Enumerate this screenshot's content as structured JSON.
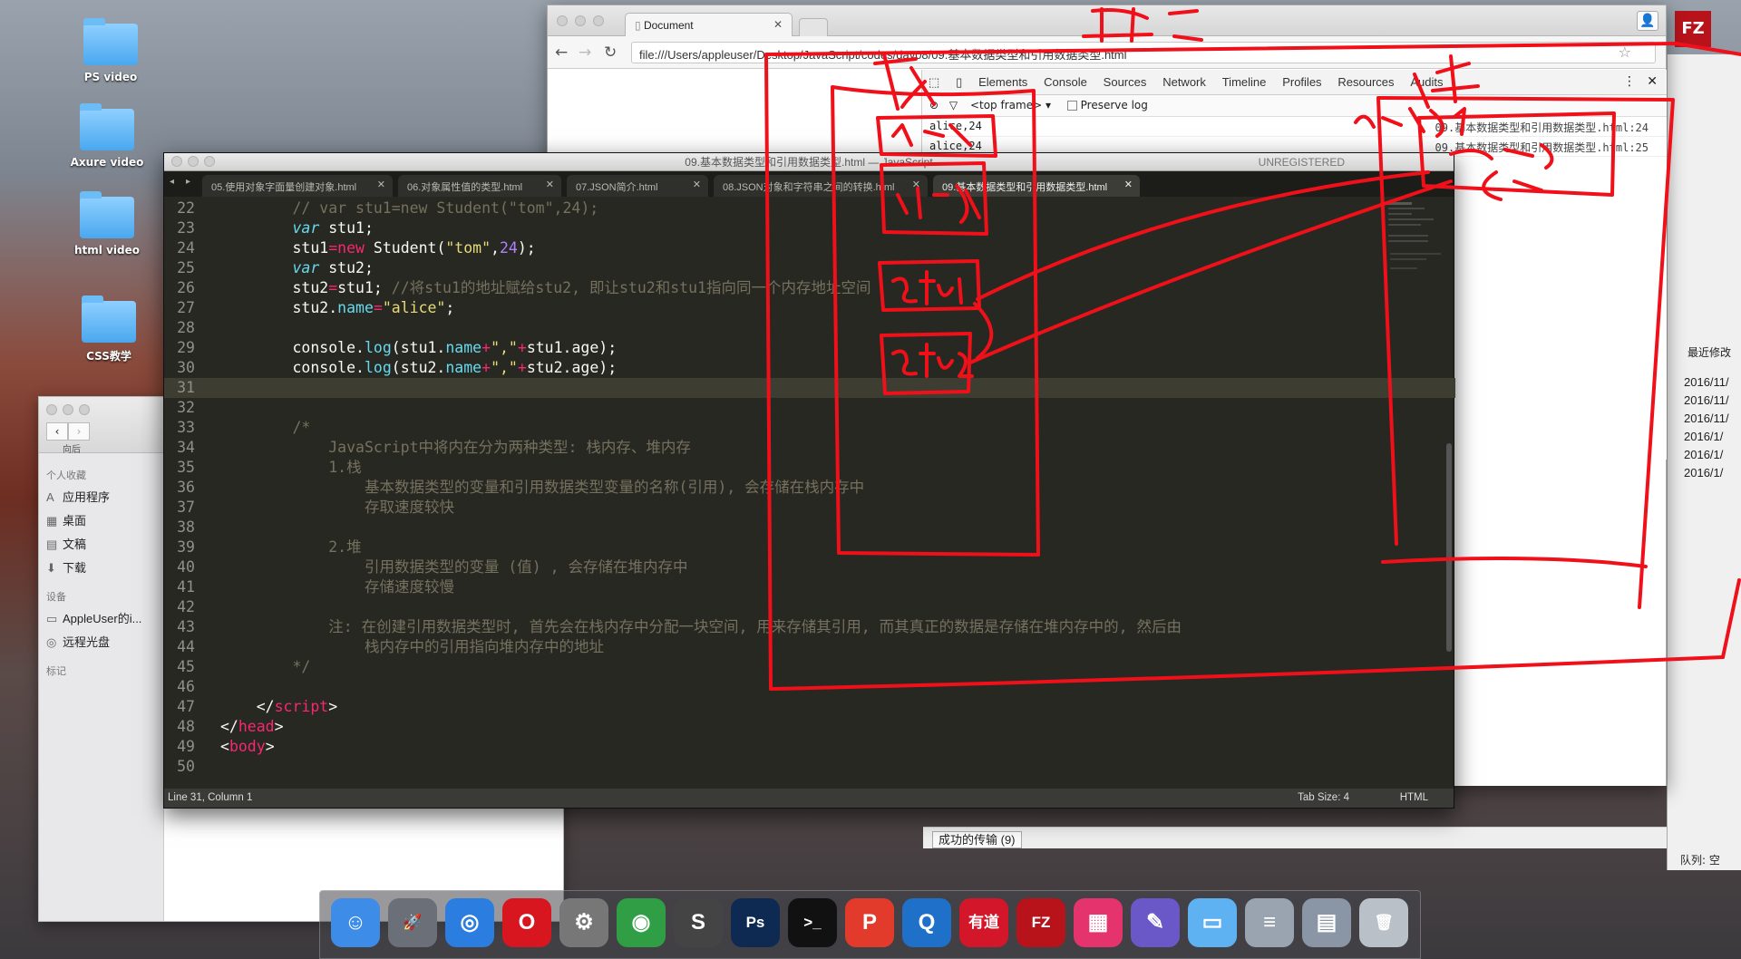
{
  "desktop": {
    "icons": [
      {
        "label": "PS video"
      },
      {
        "label": "Axure video"
      },
      {
        "label": "html video"
      },
      {
        "label": "CSS教学"
      }
    ]
  },
  "browser": {
    "tab_title": "Document",
    "url": "file:///Users/appleuser/Desktop/JavaScript/codes/day08/09.基本数据类型和引用数据类型.html",
    "devtools": {
      "tabs": [
        "Elements",
        "Console",
        "Sources",
        "Network",
        "Timeline",
        "Profiles",
        "Resources",
        "Audits"
      ],
      "active_tab": "Console",
      "frame": "<top frame>",
      "preserve_log": "Preserve log",
      "console_rows": [
        {
          "text": "alice,24",
          "source": "09.基本数据类型和引用数据类型.html:24"
        },
        {
          "text": "alice,24",
          "source": "09.基本数据类型和引用数据类型.html:25"
        }
      ]
    }
  },
  "finder": {
    "back_label": "向后",
    "sections": [
      {
        "title": "个人收藏",
        "items": [
          {
            "icon": "applications-icon",
            "label": "应用程序"
          },
          {
            "icon": "desktop-icon",
            "label": "桌面"
          },
          {
            "icon": "documents-icon",
            "label": "文稿"
          },
          {
            "icon": "downloads-icon",
            "label": "下载"
          }
        ]
      },
      {
        "title": "设备",
        "items": [
          {
            "icon": "computer-icon",
            "label": "AppleUser的i..."
          },
          {
            "icon": "disc-icon",
            "label": "远程光盘"
          }
        ]
      },
      {
        "title": "标记",
        "items": []
      }
    ]
  },
  "ftp": {
    "column_header": "最近修改",
    "dates": [
      "2016/11/",
      "2016/11/",
      "2016/11/",
      "2016/1/",
      "2016/1/",
      "2016/1/"
    ],
    "transfer_tab": "成功的传输 (9)",
    "queue": "队列: 空",
    "unregistered": "UNREGISTERED"
  },
  "editor": {
    "title": "09.基本数据类型和引用数据类型.html — JavaScript",
    "tabs": [
      {
        "label": "05.使用对象字面量创建对象.html"
      },
      {
        "label": "06.对象属性值的类型.html"
      },
      {
        "label": "07.JSON简介.html"
      },
      {
        "label": "08.JSON对象和字符串之间的转换.html"
      },
      {
        "label": "09.基本数据类型和引用数据类型.html"
      }
    ],
    "active_tab_index": 4,
    "status": {
      "position": "Line 31, Column 1",
      "tab_size": "Tab Size: 4",
      "syntax": "HTML"
    },
    "current_line": 31,
    "lines": [
      {
        "n": "22",
        "tokens": [
          [
            "cm",
            "        // var stu1=new Student(\"tom\",24);"
          ]
        ]
      },
      {
        "n": "23",
        "tokens": [
          [
            "",
            "        "
          ],
          [
            "it",
            "var"
          ],
          [
            "",
            " stu1;"
          ]
        ]
      },
      {
        "n": "24",
        "tokens": [
          [
            "",
            "        stu1"
          ],
          [
            "kw",
            "="
          ],
          [
            "kw",
            "new"
          ],
          [
            "",
            " Student("
          ],
          [
            "st",
            "\"tom\""
          ],
          [
            "",
            ","
          ],
          [
            "nu",
            "24"
          ],
          [
            "",
            ");"
          ]
        ]
      },
      {
        "n": "25",
        "tokens": [
          [
            "",
            "        "
          ],
          [
            "it",
            "var"
          ],
          [
            "",
            " stu2;"
          ]
        ]
      },
      {
        "n": "26",
        "tokens": [
          [
            "",
            "        stu2"
          ],
          [
            "kw",
            "="
          ],
          [
            "",
            "stu1; "
          ],
          [
            "cm",
            "//将stu1的地址赋给stu2, 即让stu2和stu1指向同一个内存地址空间"
          ]
        ]
      },
      {
        "n": "27",
        "tokens": [
          [
            "",
            "        stu2."
          ],
          [
            "fn",
            "name"
          ],
          [
            "kw",
            "="
          ],
          [
            "st",
            "\"alice\""
          ],
          [
            "",
            ";"
          ]
        ]
      },
      {
        "n": "28",
        "tokens": []
      },
      {
        "n": "29",
        "tokens": [
          [
            "",
            "        console."
          ],
          [
            "fn",
            "log"
          ],
          [
            "",
            "(stu1."
          ],
          [
            "fn",
            "name"
          ],
          [
            "kw",
            "+"
          ],
          [
            "st",
            "\",\""
          ],
          [
            "kw",
            "+"
          ],
          [
            "",
            "stu1.age);"
          ]
        ]
      },
      {
        "n": "30",
        "tokens": [
          [
            "",
            "        console."
          ],
          [
            "fn",
            "log"
          ],
          [
            "",
            "(stu2."
          ],
          [
            "fn",
            "name"
          ],
          [
            "kw",
            "+"
          ],
          [
            "st",
            "\",\""
          ],
          [
            "kw",
            "+"
          ],
          [
            "",
            "stu2.age);"
          ]
        ]
      },
      {
        "n": "31",
        "tokens": []
      },
      {
        "n": "32",
        "tokens": []
      },
      {
        "n": "33",
        "tokens": [
          [
            "cm",
            "        /*"
          ]
        ]
      },
      {
        "n": "34",
        "tokens": [
          [
            "cm",
            "            JavaScript中将内在分为两种类型: 栈内存、堆内存"
          ]
        ]
      },
      {
        "n": "35",
        "tokens": [
          [
            "cm",
            "            1.栈"
          ]
        ]
      },
      {
        "n": "36",
        "tokens": [
          [
            "cm",
            "                基本数据类型的变量和引用数据类型变量的名称(引用), 会存储在栈内存中"
          ]
        ]
      },
      {
        "n": "37",
        "tokens": [
          [
            "cm",
            "                存取速度较快"
          ]
        ]
      },
      {
        "n": "38",
        "tokens": []
      },
      {
        "n": "39",
        "tokens": [
          [
            "cm",
            "            2.堆"
          ]
        ]
      },
      {
        "n": "40",
        "tokens": [
          [
            "cm",
            "                引用数据类型的变量 (值) , 会存储在堆内存中"
          ]
        ]
      },
      {
        "n": "41",
        "tokens": [
          [
            "cm",
            "                存储速度较慢"
          ]
        ]
      },
      {
        "n": "42",
        "tokens": []
      },
      {
        "n": "43",
        "tokens": [
          [
            "cm",
            "            注: 在创建引用数据类型时, 首先会在栈内存中分配一块空间, 用来存储其引用, 而其真正的数据是存储在堆内存中的, 然后由"
          ]
        ]
      },
      {
        "n": "44",
        "tokens": [
          [
            "cm",
            "                栈内存中的引用指向堆内存中的地址"
          ]
        ]
      },
      {
        "n": "45",
        "tokens": [
          [
            "cm",
            "        */"
          ]
        ]
      },
      {
        "n": "46",
        "tokens": []
      },
      {
        "n": "47",
        "tokens": [
          [
            "",
            "    </"
          ],
          [
            "kw",
            "script"
          ],
          [
            "",
            ">"
          ]
        ]
      },
      {
        "n": "48",
        "tokens": [
          [
            "",
            "</"
          ],
          [
            "kw",
            "head"
          ],
          [
            "",
            ">"
          ]
        ]
      },
      {
        "n": "49",
        "tokens": [
          [
            "",
            "<"
          ],
          [
            "kw",
            "body"
          ],
          [
            "",
            ">"
          ]
        ]
      },
      {
        "n": "50",
        "tokens": []
      }
    ]
  },
  "dock": {
    "apps": [
      {
        "name": "finder-icon",
        "color": "#3d8de8",
        "glyph": "☺"
      },
      {
        "name": "launchpad-icon",
        "color": "#6b6f78",
        "glyph": "🚀"
      },
      {
        "name": "safari-icon",
        "color": "#2b7de0",
        "glyph": "◎"
      },
      {
        "name": "opera-icon",
        "color": "#d8161f",
        "glyph": "O"
      },
      {
        "name": "system-preferences-icon",
        "color": "#777",
        "glyph": "⚙"
      },
      {
        "name": "chrome-icon",
        "color": "#2f9e44",
        "glyph": "◉"
      },
      {
        "name": "sublime-text-icon",
        "color": "#444",
        "glyph": "S"
      },
      {
        "name": "photoshop-icon",
        "color": "#0f2a52",
        "glyph": "Ps"
      },
      {
        "name": "terminal-icon",
        "color": "#111",
        "glyph": ">_"
      },
      {
        "name": "wps-icon",
        "color": "#e23b2b",
        "glyph": "P"
      },
      {
        "name": "quicktime-icon",
        "color": "#1e70c9",
        "glyph": "Q"
      },
      {
        "name": "youdao-icon",
        "color": "#d4162a",
        "glyph": "有道"
      },
      {
        "name": "filezilla-icon",
        "color": "#b8131b",
        "glyph": "FZ"
      },
      {
        "name": "xmind-icon",
        "color": "#e5336d",
        "glyph": "▦"
      },
      {
        "name": "preview-icon",
        "color": "#6a57c8",
        "glyph": "✎"
      },
      {
        "name": "folder-icon",
        "color": "#5fb2f2",
        "glyph": "▭"
      },
      {
        "name": "document-icon",
        "color": "#9aa4b0",
        "glyph": "≡"
      },
      {
        "name": "screenshots-icon",
        "color": "#8a96a6",
        "glyph": "▤"
      },
      {
        "name": "trash-icon",
        "color": "#b9c0c8",
        "glyph": "🗑"
      }
    ]
  }
}
